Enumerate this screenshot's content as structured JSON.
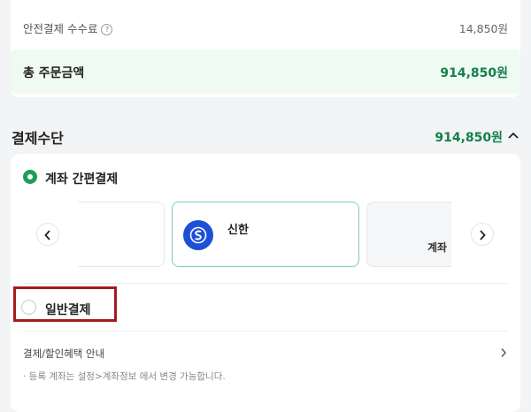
{
  "summary": {
    "fee_label": "안전결제 수수료",
    "fee_help_icon": "question-circle-icon",
    "fee_value": "14,850원",
    "total_label": "총 주문금액",
    "total_value": "914,850원"
  },
  "payment": {
    "title": "결제수단",
    "amount": "914,850원",
    "collapse_icon": "chevron-up-icon",
    "easy_option": {
      "label": "계좌 간편결제",
      "selected": true
    },
    "banks": [
      {
        "name": "",
        "logo_icon": "",
        "state": "partial"
      },
      {
        "name": "신한",
        "logo_icon": "shinhan-logo-icon",
        "state": "selected"
      },
      {
        "name": "계좌",
        "logo_icon": "",
        "state": "partial"
      }
    ],
    "general_option": {
      "label": "일반결제",
      "selected": false
    },
    "benefit_link": "결제/할인혜택 안내",
    "note": "· 등록 계좌는 설정>계좌정보 에서 변경 가능합니다."
  },
  "colors": {
    "accent_green": "#14804a",
    "radio_green": "#1e9e57",
    "total_bg": "#eefaf2",
    "highlight_box": "#a51b1b",
    "bank_logo_blue": "#1d4fd7"
  }
}
